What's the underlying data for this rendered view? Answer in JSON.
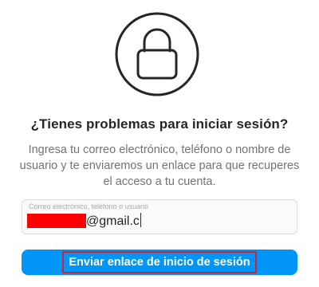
{
  "header": {
    "icon": "lock-icon",
    "title": "¿Tienes problemas para iniciar sesión?",
    "description": "Ingresa tu correo electrónico, teléfono o nombre de usuario y te enviaremos un enlace para que recuperes el acceso a tu cuenta."
  },
  "form": {
    "input_placeholder": "Correo electrónico, teléfono o usuario",
    "input_value": "@gmail.c",
    "submit_label": "Enviar enlace de inicio de sesión"
  },
  "colors": {
    "primary_button": "#0095f6",
    "highlight_border": "#d3212d",
    "redaction": "#ff0000"
  }
}
